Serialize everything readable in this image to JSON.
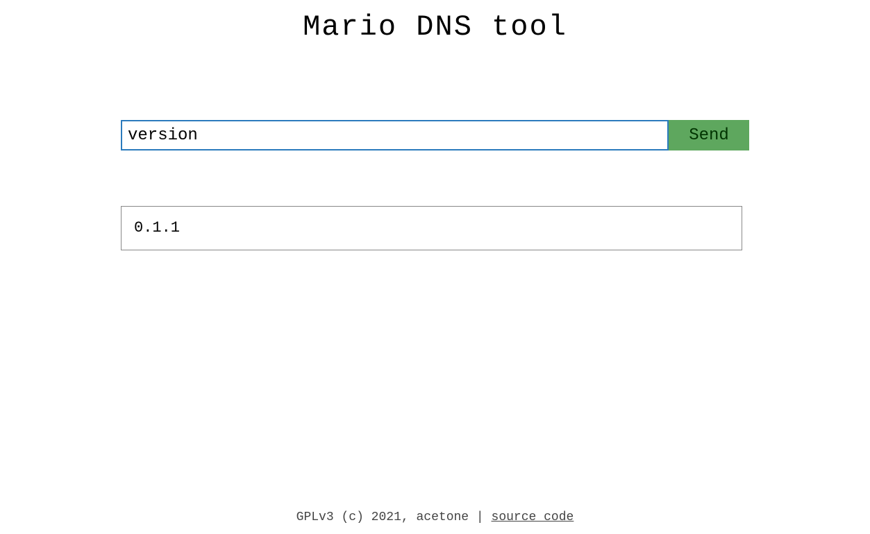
{
  "header": {
    "title": "Mario DNS tool"
  },
  "form": {
    "input_value": "version",
    "send_label": "Send"
  },
  "result": {
    "text": "0.1.1"
  },
  "footer": {
    "license_text": "GPLv3 (c) 2021, acetone | ",
    "link_text": "source code"
  }
}
